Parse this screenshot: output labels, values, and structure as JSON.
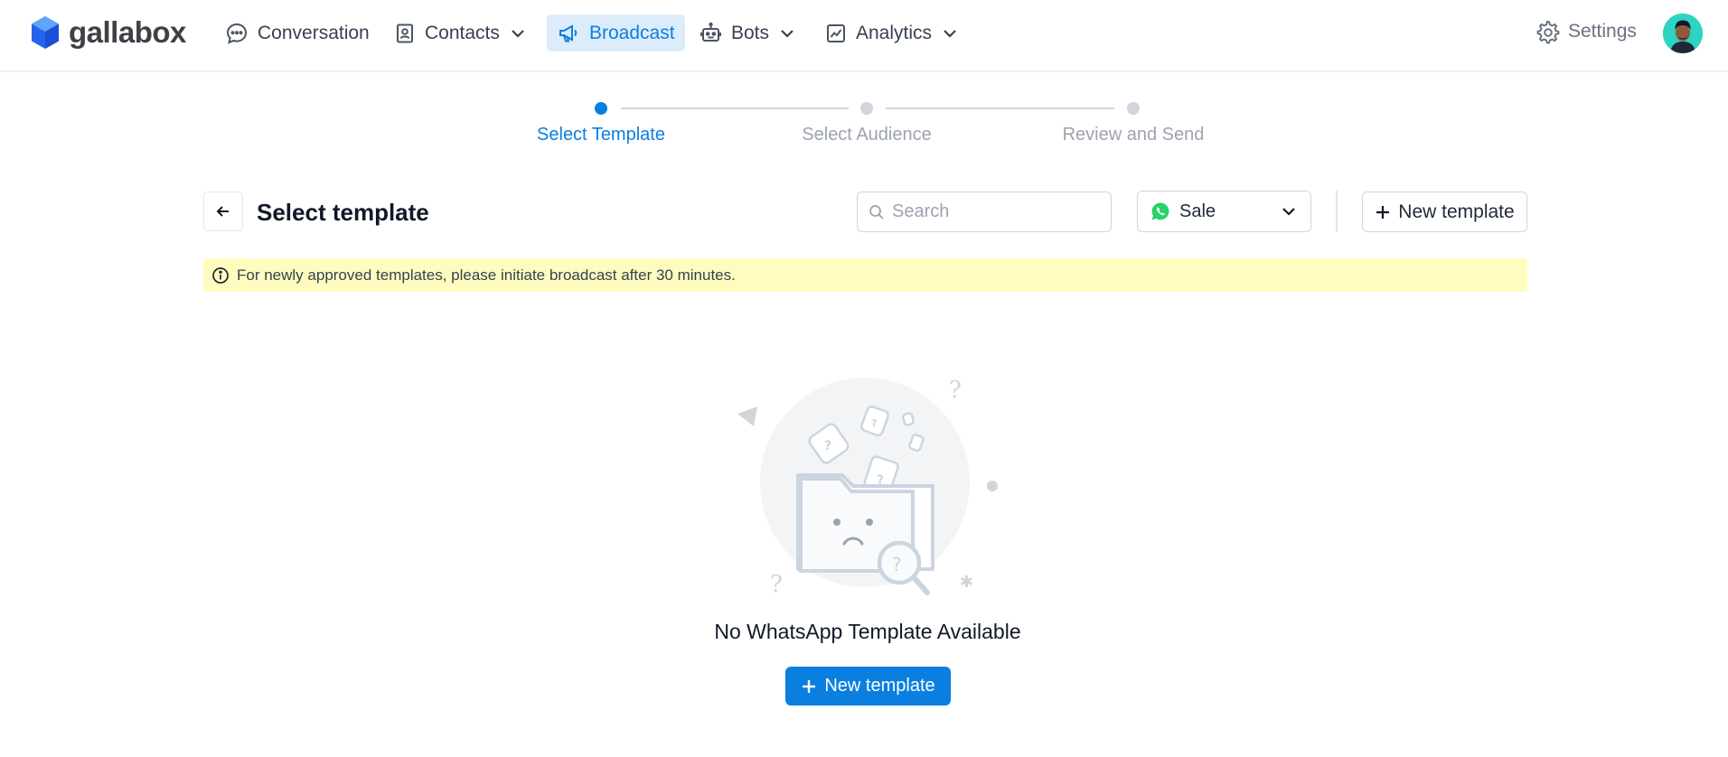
{
  "app": {
    "logo_text": "gallabox"
  },
  "nav": {
    "items": [
      {
        "label": "Conversation",
        "icon": "chat-bubble-icon"
      },
      {
        "label": "Contacts",
        "icon": "contact-book-icon",
        "has_dropdown": true
      },
      {
        "label": "Broadcast",
        "icon": "megaphone-icon",
        "active": true
      },
      {
        "label": "Bots",
        "icon": "robot-icon",
        "has_dropdown": true
      },
      {
        "label": "Analytics",
        "icon": "chart-icon",
        "has_dropdown": true
      }
    ],
    "settings_label": "Settings"
  },
  "stepper": {
    "steps": [
      {
        "label": "Select Template",
        "active": true
      },
      {
        "label": "Select Audience",
        "active": false
      },
      {
        "label": "Review and Send",
        "active": false
      }
    ]
  },
  "header": {
    "title": "Select template",
    "search_placeholder": "Search",
    "channel_select_value": "Sale",
    "new_template_label": "New template"
  },
  "notice": {
    "text": "For newly approved templates, please initiate broadcast after 30 minutes."
  },
  "empty_state": {
    "title": "No WhatsApp Template Available",
    "button_label": "New template"
  },
  "colors": {
    "accent": "#0b7fe0",
    "accent_bg": "#dcecfb",
    "notice_bg": "#fefcbf",
    "whatsapp_green": "#25d366"
  }
}
